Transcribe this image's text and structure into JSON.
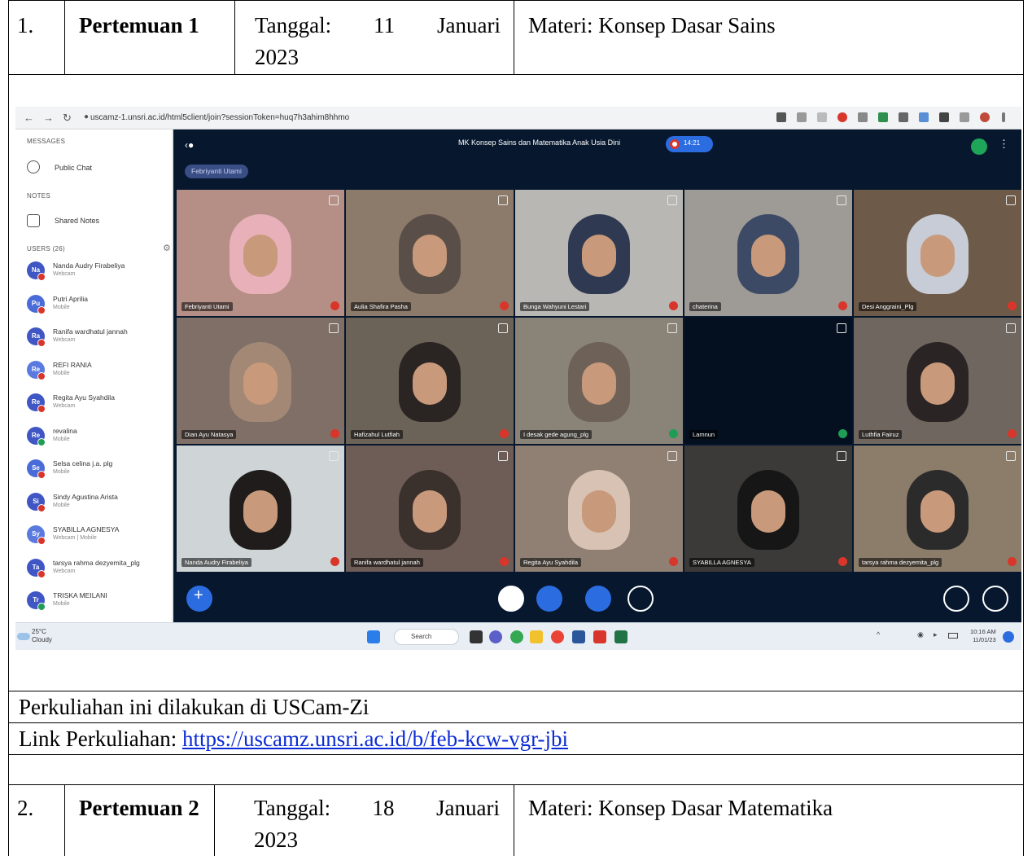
{
  "row1": {
    "no": "1.",
    "meeting": "Pertemuan 1",
    "date_label": "Tanggal:",
    "date_day": "11",
    "date_month": "Januari",
    "date_year": "2023",
    "topic": "Materi: Konsep Dasar Sains"
  },
  "screenshot": {
    "url": "uscamz-1.unsri.ac.id/html5client/join?sessionToken=huq7h3ahim8hhmo",
    "sidebar": {
      "messages_heading": "MESSAGES",
      "public_chat": "Public Chat",
      "notes_heading": "NOTES",
      "shared_notes": "Shared Notes",
      "users_heading": "USERS (26)",
      "users": [
        {
          "initials": "Na",
          "name": "Nanda Audry Firabeliya",
          "status": "Webcam"
        },
        {
          "initials": "Pu",
          "name": "Putri Aprilia",
          "status": "Mobile"
        },
        {
          "initials": "Ra",
          "name": "Ranifa wardhatul jannah",
          "status": "Webcam"
        },
        {
          "initials": "Re",
          "name": "REFI RANIA",
          "status": "Mobile"
        },
        {
          "initials": "Re",
          "name": "Regita Ayu Syahdila",
          "status": "Webcam"
        },
        {
          "initials": "Re",
          "name": "revalina",
          "status": "Mobile"
        },
        {
          "initials": "Se",
          "name": "Selsa celina j.a. plg",
          "status": "Mobile"
        },
        {
          "initials": "Si",
          "name": "Sindy Agustina Arista",
          "status": "Mobile"
        },
        {
          "initials": "Sy",
          "name": "SYABILLA AGNESYA",
          "status": "Webcam | Mobile"
        },
        {
          "initials": "Ta",
          "name": "tarsya rahma dezyemita_plg",
          "status": "Webcam"
        },
        {
          "initials": "Tr",
          "name": "TRISKA MEILANI",
          "status": "Mobile"
        }
      ]
    },
    "conference": {
      "title": "MK Konsep Sains dan Matematika Anak Usia Dini",
      "timer": "14:21",
      "talking": "Febriyanti Utami",
      "tiles": [
        "Febriyanti Utami",
        "Aulia Shafira Pasha",
        "Bunga Wahyuni Lestari",
        "chaterina",
        "Desi Anggraini_Plg",
        "Dian Ayu Natasya",
        "Hafizahul Lutfiah",
        "I desak gede agung_plg",
        "Lamnun",
        "Luthfia Fairuz",
        "Nanda Audry Firabeliya",
        "Ranifa wardhatul jannah",
        "Regita Ayu Syahdila",
        "SYABILLA AGNESYA",
        "tarsya rahma dezyemita_plg"
      ]
    },
    "taskbar": {
      "temp": "25°C",
      "weather": "Cloudy",
      "search": "Search",
      "time": "10:16 AM",
      "date": "11/01/23"
    }
  },
  "caption_line": "Perkuliahan ini dilakukan di USCam-Zi",
  "link_label": "Link Perkuliahan:",
  "link_url": "https://uscamz.unsri.ac.id/b/feb-kcw-vgr-jbi",
  "row2": {
    "no": "2.",
    "meeting": "Pertemuan 2",
    "date_label": "Tanggal:",
    "date_day": "18",
    "date_month": "Januari",
    "date_year": "2023",
    "topic": "Materi: Konsep Dasar Matematika"
  }
}
